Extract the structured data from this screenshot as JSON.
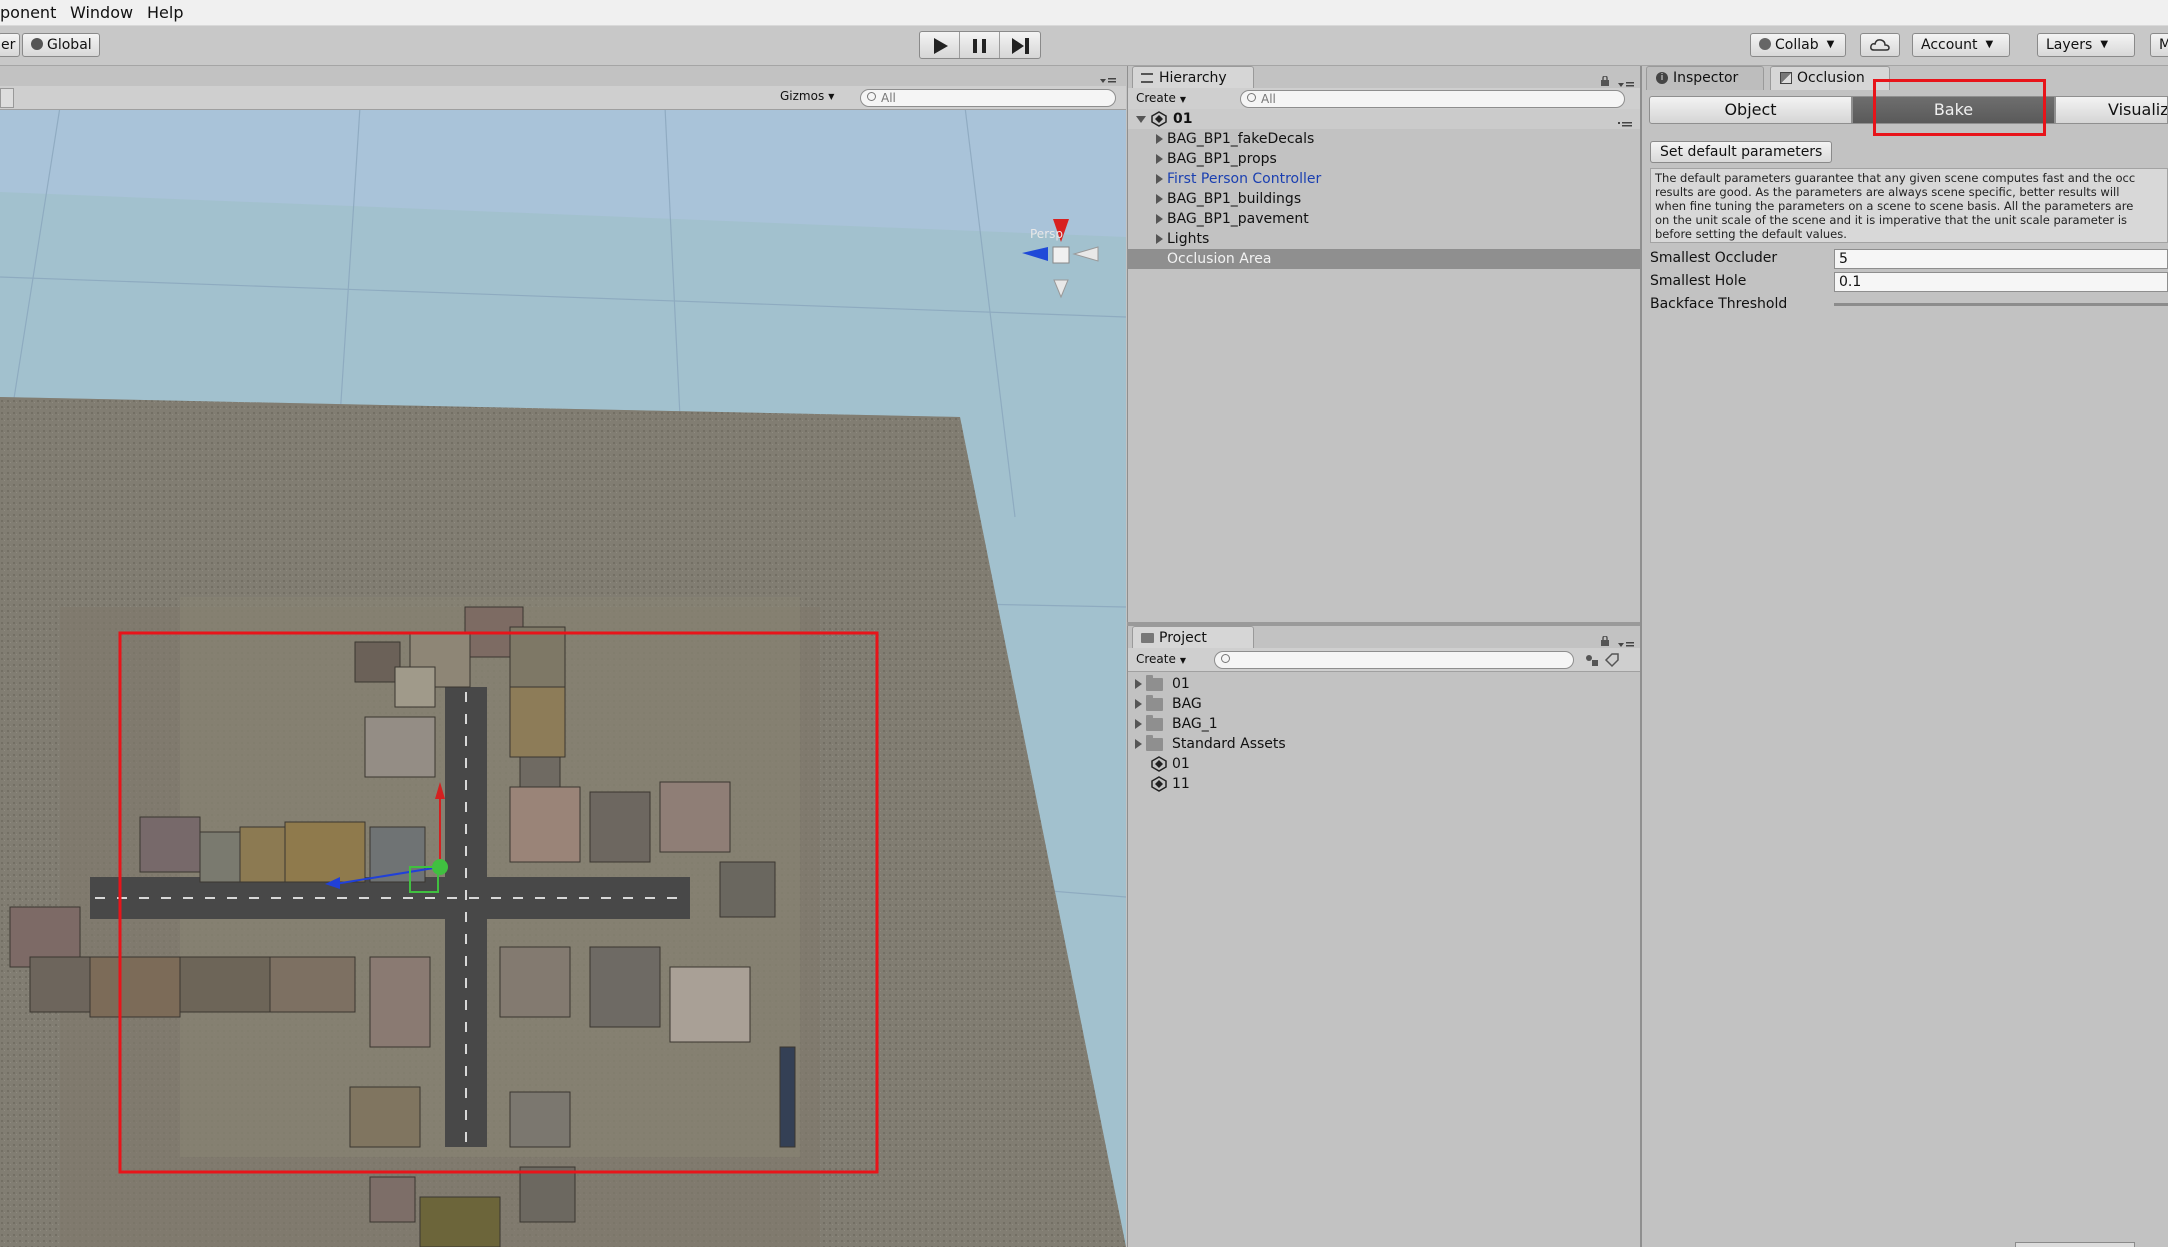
{
  "menubar": {
    "items": [
      "ponent",
      "Window",
      "Help"
    ]
  },
  "toolbar": {
    "pivot_label": "er",
    "global_label": "Global",
    "collab_label": "Collab",
    "account_label": "Account",
    "layers_label": "Layers",
    "layout_label": "M"
  },
  "scene": {
    "gizmos_label": "Gizmos",
    "search_placeholder": "All",
    "persp_label": "Persp"
  },
  "hierarchy": {
    "tab_label": "Hierarchy",
    "create_label": "Create",
    "search_placeholder": "All",
    "scene_name": "01",
    "items": [
      {
        "label": "BAG_BP1_fakeDecals",
        "expandable": true,
        "style": "normal"
      },
      {
        "label": "BAG_BP1_props",
        "expandable": true,
        "style": "normal"
      },
      {
        "label": "First Person Controller",
        "expandable": true,
        "style": "prefab"
      },
      {
        "label": "BAG_BP1_buildings",
        "expandable": true,
        "style": "normal"
      },
      {
        "label": "BAG_BP1_pavement",
        "expandable": true,
        "style": "normal"
      },
      {
        "label": "Lights",
        "expandable": true,
        "style": "normal"
      },
      {
        "label": "Occlusion Area",
        "expandable": false,
        "style": "selected"
      }
    ]
  },
  "project": {
    "tab_label": "Project",
    "create_label": "Create",
    "items": [
      {
        "label": "01",
        "type": "folder"
      },
      {
        "label": "BAG",
        "type": "folder"
      },
      {
        "label": "BAG_1",
        "type": "folder"
      },
      {
        "label": "Standard Assets",
        "type": "folder"
      },
      {
        "label": "01",
        "type": "scene"
      },
      {
        "label": "11",
        "type": "scene"
      }
    ]
  },
  "inspector": {
    "tab_inspector": "Inspector",
    "tab_occlusion": "Occlusion",
    "segments": [
      "Object",
      "Bake",
      "Visualiza"
    ],
    "active_segment": "Bake",
    "set_default_label": "Set default parameters",
    "description": [
      "The default parameters guarantee that any given scene computes fast and the occ",
      "results are good. As the parameters are always scene specific, better results will",
      "when fine tuning the parameters on a scene to scene basis. All the parameters are",
      "on the unit scale of the scene and it is imperative that the unit scale parameter is",
      "before setting the default values."
    ],
    "fields": [
      {
        "label": "Smallest Occluder",
        "value": "5"
      },
      {
        "label": "Smallest Hole",
        "value": "0.1"
      },
      {
        "label": "Backface Threshold",
        "value": ""
      }
    ]
  },
  "colors": {
    "highlight": "#e8141a",
    "prefab_text": "#1a3fb0",
    "selection": "#8f8f8f"
  }
}
